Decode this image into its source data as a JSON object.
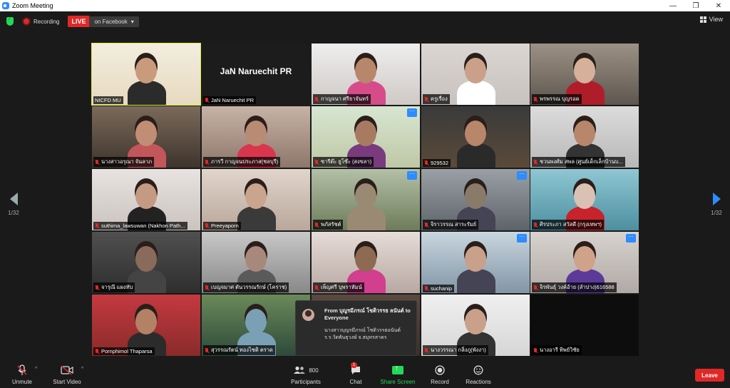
{
  "window": {
    "title": "Zoom Meeting"
  },
  "topbar": {
    "recording": "Recording",
    "live": "LIVE",
    "live_destination": "on Facebook",
    "view": "View"
  },
  "pager": {
    "left_page": "1/32",
    "right_page": "1/32"
  },
  "participants": [
    {
      "name": "NICFD MU",
      "active": true,
      "muted": false
    },
    {
      "name": "JaN Naruechit PR",
      "muted": true,
      "big_name": "JaN Naruechit PR"
    },
    {
      "name": "กาญจนา ศรีธาจันทร์",
      "muted": true
    },
    {
      "name": "ครูเรื่อง",
      "muted": true
    },
    {
      "name": "พรพรรณ บุญรอด",
      "muted": true
    },
    {
      "name": "นางสาวอรุณา จันลาภ",
      "muted": true
    },
    {
      "name": "ภารวี กาญจนประภาส(ชลบุรี)",
      "muted": true
    },
    {
      "name": "ซารีด๊ะ ยูโซ๊ะ (สงขลา)",
      "muted": true,
      "menu": true
    },
    {
      "name": "929532",
      "muted": true
    },
    {
      "name": "ชวนพงศ์ม สพล (ศูนย์เด็กเล็กบ้านบ...",
      "muted": true
    },
    {
      "name": "suthima_lawsuwan (Nakhon Path...",
      "muted": true
    },
    {
      "name": "Preeyaporn",
      "muted": true
    },
    {
      "name": "พภัสรัชต์",
      "muted": true,
      "menu": true
    },
    {
      "name": "จิราวรรณ สาระรัมย์",
      "muted": true,
      "menu": true
    },
    {
      "name": "ศิรประภา สวัสดี (กรุงเทพฯ)",
      "muted": true
    },
    {
      "name": "จารุณี แผงทับ",
      "muted": true
    },
    {
      "name": "เบญจมาศ ตันวรรณรักษ์ (โคราช)",
      "muted": true
    },
    {
      "name": "เพ็ญศรี บุพราหัมน์",
      "muted": true
    },
    {
      "name": "suchanip",
      "muted": true,
      "menu": true
    },
    {
      "name": "จิรพันธุ์ วงค์อ้าย (ลำปาง)616588",
      "muted": true,
      "menu": true
    },
    {
      "name": "Pornphimol Thaparsa",
      "muted": true
    },
    {
      "name": "สุวรรณรัตน์ ทองไชติ ตราด",
      "muted": true
    },
    {
      "name": "",
      "muted": false
    },
    {
      "name": "นางวรรณา กลิ่งภู(พังงา)",
      "muted": true
    },
    {
      "name": "นางอารี ทิพย์วิชัย",
      "muted": true
    }
  ],
  "chat_popup": {
    "from": "From บุญรมีภรณ์ โชติวรรธ ลนันต์ to Everyone",
    "message": "นางสาวบุญรมีภรณ์ โชติวรรธอนันต์ ร.ร.วัดพันธุวงษ์ จ.สมุทรสาคร"
  },
  "toolbar": {
    "unmute": "Unmute",
    "start_video": "Start Video",
    "participants": "Participants",
    "participants_count": "800",
    "chat": "Chat",
    "chat_badge": "1",
    "share_screen": "Share Screen",
    "record": "Record",
    "reactions": "Reactions",
    "leave": "Leave"
  }
}
